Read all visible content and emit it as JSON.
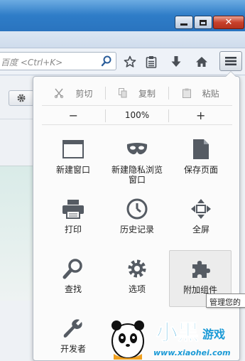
{
  "search": {
    "placeholder": "百度 <Ctrl+K>"
  },
  "edit": {
    "cut": "剪切",
    "copy": "复制",
    "paste": "粘贴"
  },
  "zoom": {
    "out": "−",
    "level": "100%",
    "in": "+"
  },
  "items": [
    {
      "label": "新建窗口",
      "icon": "window-icon"
    },
    {
      "label": "新建隐私浏览",
      "label2": "窗口",
      "icon": "mask-icon"
    },
    {
      "label": "保存页面",
      "icon": "page-icon"
    },
    {
      "label": "打印",
      "icon": "printer-icon"
    },
    {
      "label": "历史记录",
      "icon": "clock-icon"
    },
    {
      "label": "全屏",
      "icon": "fullscreen-icon"
    },
    {
      "label": "查找",
      "icon": "magnifier-icon"
    },
    {
      "label": "选项",
      "icon": "gear-icon"
    },
    {
      "label": "附加组件",
      "icon": "puzzle-icon"
    },
    {
      "label": "开发者",
      "icon": "wrench-icon"
    }
  ],
  "tooltip": "管理您的",
  "watermark": {
    "title": "小黑游戏",
    "url": "www.xiaohei.com"
  },
  "colors": {
    "icon": "#555b63",
    "accent": "#2a74bf"
  }
}
